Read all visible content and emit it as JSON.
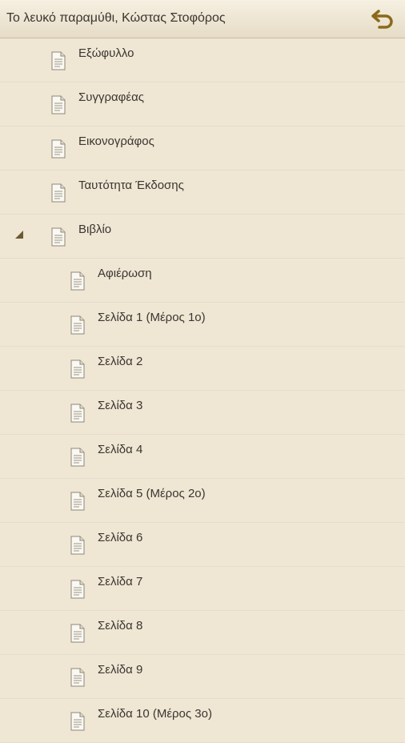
{
  "header": {
    "title": "Το λευκό παραμύθι, Κώστας Στοφόρος",
    "back_icon": "back-arrow-icon"
  },
  "colors": {
    "background": "#efe6d4",
    "back_icon": "#8a6a1a"
  },
  "toc": {
    "items": [
      {
        "label": "Εξώφυλλο",
        "level": 0
      },
      {
        "label": "Συγγραφέας",
        "level": 0
      },
      {
        "label": "Εικονογράφος",
        "level": 0
      },
      {
        "label": "Ταυτότητα Έκδοσης",
        "level": 0
      },
      {
        "label": "Βιβλίο",
        "level": 0,
        "expanded": true
      },
      {
        "label": "Αφιέρωση",
        "level": 1
      },
      {
        "label": "Σελίδα 1 (Μέρος 1ο)",
        "level": 1
      },
      {
        "label": "Σελίδα 2",
        "level": 1
      },
      {
        "label": "Σελίδα 3",
        "level": 1
      },
      {
        "label": "Σελίδα 4",
        "level": 1
      },
      {
        "label": "Σελίδα 5 (Μέρος 2ο)",
        "level": 1
      },
      {
        "label": "Σελίδα 6",
        "level": 1
      },
      {
        "label": "Σελίδα 7",
        "level": 1
      },
      {
        "label": "Σελίδα 8",
        "level": 1
      },
      {
        "label": "Σελίδα 9",
        "level": 1
      },
      {
        "label": "Σελίδα 10 (Μέρος 3ο)",
        "level": 1
      }
    ]
  }
}
